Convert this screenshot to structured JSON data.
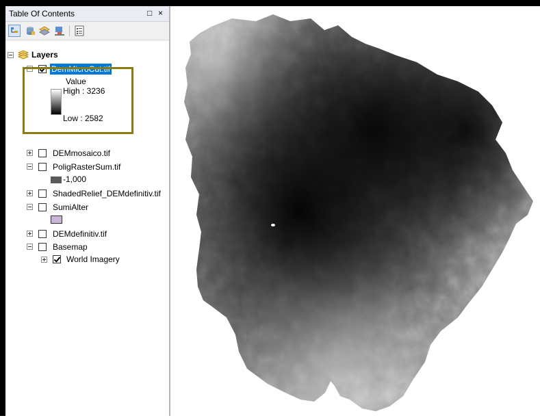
{
  "toc": {
    "title": "Table Of Contents",
    "restore_glyph": "□",
    "close_glyph": "×",
    "toolbar": [
      "list-by-drawing-order-icon",
      "list-by-source-icon",
      "list-by-visibility-icon",
      "list-by-selection-icon",
      "options-icon"
    ],
    "root": {
      "label": "Layers",
      "icon": "layers-stack-icon"
    },
    "layers": [
      {
        "label": "DemMicroCut.tif",
        "checked": true,
        "expanded": true,
        "selected": true,
        "legend": {
          "heading": "Value",
          "high": "High : 3236",
          "low": "Low : 2582"
        }
      },
      {
        "label": "DEMmosaico.tif",
        "checked": false,
        "expanded": false
      },
      {
        "label": "PoligRasterSum.tif",
        "checked": false,
        "expanded": true,
        "legend_item": {
          "label": "-1,000",
          "color": "#5a5a5a"
        }
      },
      {
        "label": "ShadedRelief_DEMdefinitiv.tif",
        "checked": false,
        "expanded": false
      },
      {
        "label": "SumiAlter",
        "checked": false,
        "expanded": true,
        "legend_item": {
          "label": "",
          "color": "#c9b6d6"
        }
      },
      {
        "label": "DEMdefinitiv.tif",
        "checked": false,
        "expanded": false
      },
      {
        "label": "Basemap",
        "checked": false,
        "expanded": true
      },
      {
        "label": "World Imagery",
        "checked": true,
        "expanded": false
      }
    ]
  },
  "colors": {
    "selection": "#0078d7",
    "highlight_border": "#8a7a12",
    "ramp_high": "#ffffff",
    "ramp_low": "#000000"
  }
}
